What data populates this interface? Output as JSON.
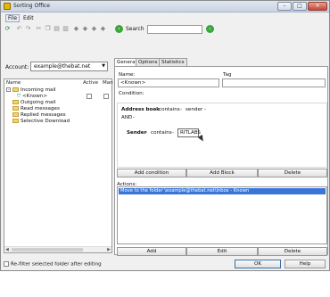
{
  "window": {
    "title": "Sorting Office",
    "controls": [
      "–",
      "□",
      "×"
    ]
  },
  "menu": {
    "file": "File",
    "edit": "Edit"
  },
  "search": {
    "label": "Search",
    "value": ""
  },
  "account": {
    "label": "Account:",
    "value": "example@thebat.net"
  },
  "left_pane": {
    "columns": {
      "name": "Name",
      "active": "Active",
      "man": "Man"
    },
    "tree": [
      {
        "label": "Incoming mail",
        "indent": 0,
        "expander": "-"
      },
      {
        "label": "<Known>",
        "indent": 1
      },
      {
        "label": "Outgoing mail",
        "indent": 1
      },
      {
        "label": "Read messages",
        "indent": 1
      },
      {
        "label": "Replied messages",
        "indent": 1
      },
      {
        "label": "Selective Download",
        "indent": 1
      }
    ]
  },
  "refilter_label": "Re-filter selected folder after editing",
  "tabs": [
    "General",
    "Options",
    "Statistics"
  ],
  "general": {
    "name_label": "Name:",
    "name_value": "<Known>",
    "tag_label": "Tag",
    "tag_value": "",
    "condition_label": "Condition:",
    "cond1": {
      "field": "Address book",
      "op": "contains",
      "value": "sender"
    },
    "and_text": "AND",
    "cond2": {
      "field": "Sender",
      "op": "contains",
      "value": "RITLABS"
    }
  },
  "condition_buttons": [
    "Add condition",
    "Add Block",
    "Delete"
  ],
  "actions_label": "Actions:",
  "actions": [
    "Move to the folder \\example@thebat.net\\Inbox - Known"
  ],
  "action_buttons": [
    "Add",
    "Edit",
    "Delete"
  ],
  "dialog_buttons": {
    "ok": "OK",
    "help": "Help"
  },
  "colors": {
    "selection": "#3875d7",
    "folder": "#f1d47a",
    "go": "#3aa63a"
  }
}
